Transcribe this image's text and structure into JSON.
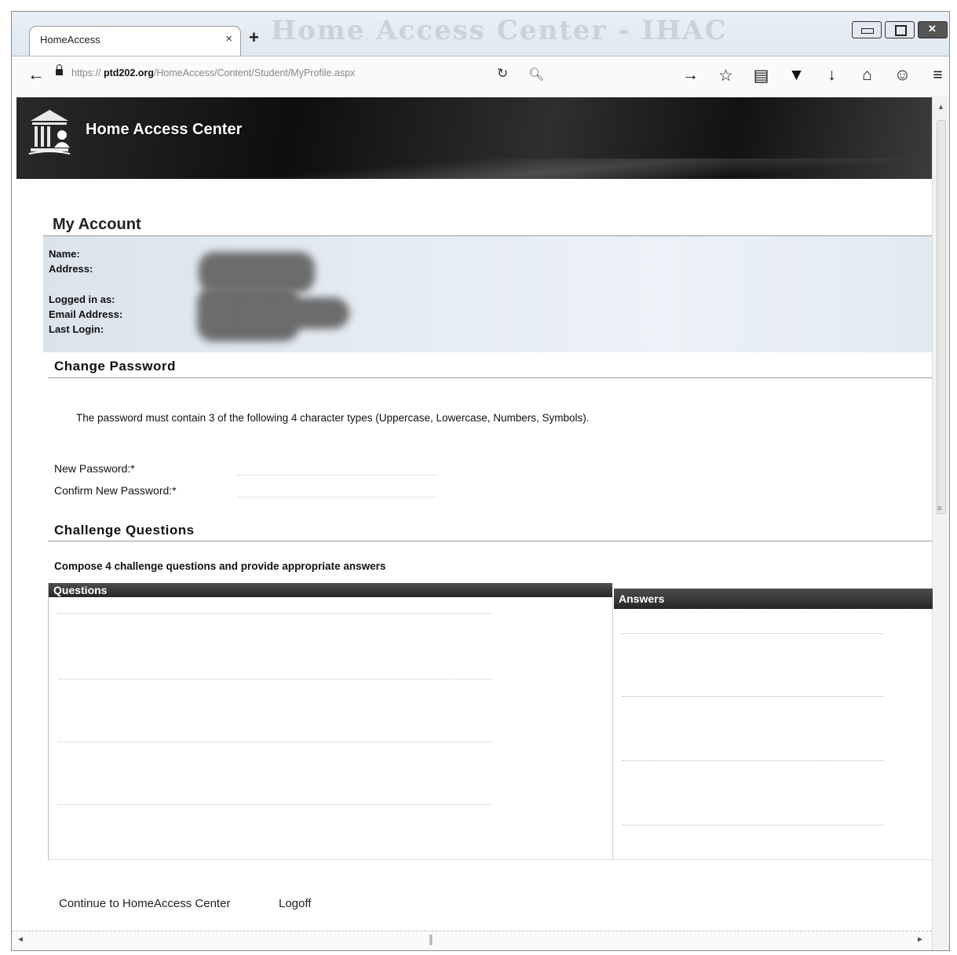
{
  "browser": {
    "window_title": "Home Access Center - IHAC",
    "tab_title": "HomeAccess",
    "tab_close": "×",
    "new_tab": "+",
    "url_prefix": "https://  ",
    "url_host": "ptd202.org",
    "url_path": "/HomeAccess/Content/Student/MyProfile.aspx",
    "toolbar_icons": [
      "arrow-right-icon",
      "star-icon",
      "reading-list-icon",
      "pocket-icon",
      "download-icon",
      "home-icon",
      "emoji-icon",
      "menu-icon"
    ]
  },
  "header": {
    "title": "Home Access Center"
  },
  "account": {
    "title": "My Account",
    "labels": {
      "name": "Name:",
      "address": "Address:",
      "logged_in": "Logged in as:",
      "email": "Email Address:",
      "last_login": "Last Login:"
    }
  },
  "change_password": {
    "title": "Change Password",
    "note": "The password must contain 3 of the following 4 character types (Uppercase, Lowercase, Numbers, Symbols).",
    "new_label": "New Password:*",
    "confirm_label": "Confirm New Password:*"
  },
  "challenge": {
    "title": "Challenge Questions",
    "note": "Compose 4 challenge questions and provide appropriate answers",
    "questions_header": "Questions",
    "answers_header": "Answers"
  },
  "footer": {
    "continue": "Continue to HomeAccess Center",
    "logoff": "Logoff"
  },
  "colors": {
    "banner": "#1a1a1a",
    "table_header": "#333333",
    "account_bg": "#e3eaf1"
  }
}
